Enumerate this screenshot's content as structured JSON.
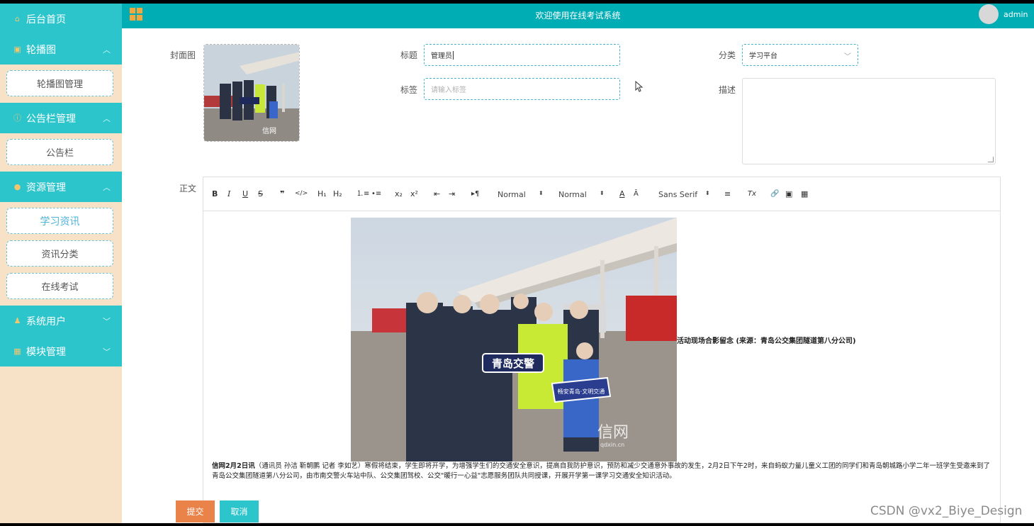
{
  "sidebar": {
    "home": "后台首页",
    "groups": [
      {
        "label": "轮播图",
        "items": [
          "轮播图管理"
        ]
      },
      {
        "label": "公告栏管理",
        "items": [
          "公告栏"
        ]
      },
      {
        "label": "资源管理",
        "items": [
          "学习资讯",
          "资讯分类",
          "在线考试"
        ]
      },
      {
        "label": "系统用户",
        "items": []
      },
      {
        "label": "模块管理",
        "items": []
      }
    ]
  },
  "header": {
    "title": "欢迎使用在线考试系统",
    "user": "admin"
  },
  "form": {
    "cover_label": "封面图",
    "title_label": "标题",
    "title_value": "管理员",
    "category_label": "分类",
    "category_value": "学习平台",
    "tag_label": "标签",
    "tag_placeholder": "请输入标签",
    "desc_label": "描述",
    "body_label": "正文"
  },
  "editor": {
    "toolbar": {
      "bold": "B",
      "italic": "I",
      "underline": "U",
      "strike": "S",
      "quote": "❞",
      "code": "</>",
      "h1": "H₁",
      "h2": "H₂",
      "ol": "⒈≡",
      "ul": "•≡",
      "sub": "x₂",
      "sup": "x²",
      "outdent": "⇤",
      "indent": "⇥",
      "direction": "▸¶",
      "size": "Normal",
      "header": "Normal",
      "color": "A",
      "background": "Ā",
      "font": "Sans Serif",
      "align": "≡",
      "clean": "Tx",
      "link": "🔗",
      "image": "▣",
      "video": "▦"
    },
    "photo_sign_text": "青岛交警",
    "photo_kid_sign": "畅安青岛·文明交通",
    "photo_watermark": "信网",
    "photo_watermark_sub": "qdxin.cn",
    "caption": "活动现场合影留念 (来源：青岛公交集团隧道第八分公司)",
    "para_lead": "信网2月2日讯",
    "para_text": "（通讯员 孙洁 靳朝鹏 记者 李如艺）寒假将结束，学生即将开学，为增强学生们的交通安全意识，提高自我防护意识，预防和减少交通意外事故的发生，2月2日下午2时，来自蚂蚁力量儿童义工团的同学们和青岛朝城路小学二年一班学生受邀来到了青岛公交集团隧道第八分公司，由市南交警火车站中队、公交集团驾校、公交\"暖行一心益\"志愿服务团队共同授课，开展开学第一课学习交通安全知识活动。"
  },
  "buttons": {
    "submit": "提交",
    "cancel": "取消"
  },
  "watermark": "CSDN @vx2_Biye_Design",
  "colors": {
    "teal": "#00adb5",
    "sidebar_head": "#2dc5cc",
    "sidebar_bg": "#f7e2c7",
    "submit": "#e9834a"
  }
}
